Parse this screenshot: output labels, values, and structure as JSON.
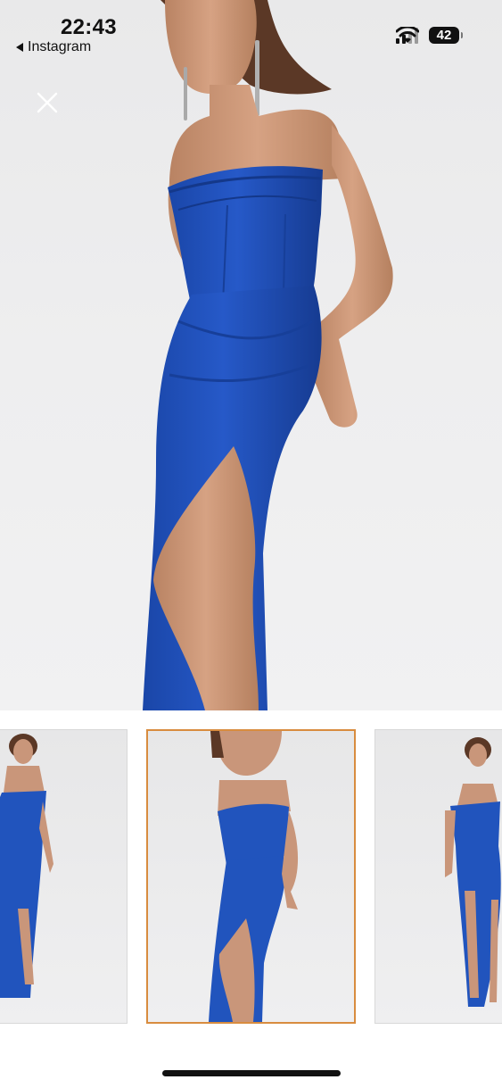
{
  "status_bar": {
    "time": "22:43",
    "back_app": "Instagram",
    "battery": "42",
    "signal_bars_active": 2,
    "signal_bars_total": 4,
    "icons": [
      "signal-bars-icon",
      "wifi-icon",
      "battery-icon"
    ]
  },
  "viewer": {
    "close_icon": "close-icon",
    "main_image": "model in royal blue strapless corset gown with thigh-high slit",
    "thumbnails": [
      {
        "name": "thumbnail-1",
        "selected": false
      },
      {
        "name": "thumbnail-2",
        "selected": true
      },
      {
        "name": "thumbnail-3",
        "selected": false
      }
    ]
  },
  "colors": {
    "dress_blue": "#1e4fb8",
    "selected_border": "#d88c3f",
    "background": "#ffffff"
  }
}
